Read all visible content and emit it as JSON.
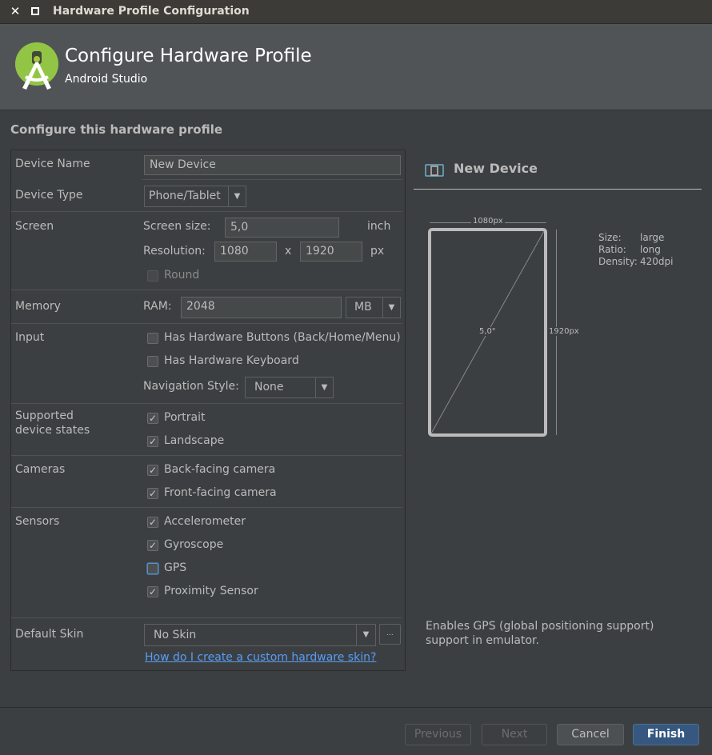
{
  "window": {
    "title": "Hardware Profile Configuration"
  },
  "header": {
    "title": "Configure Hardware Profile",
    "subtitle": "Android Studio"
  },
  "section_title": "Configure this hardware profile",
  "form": {
    "device_name": {
      "label": "Device Name",
      "value": "New Device"
    },
    "device_type": {
      "label": "Device Type",
      "value": "Phone/Tablet"
    },
    "screen": {
      "label": "Screen",
      "size_label": "Screen size:",
      "size_value": "5,0",
      "size_unit": "inch",
      "resolution_label": "Resolution:",
      "res_width": "1080",
      "res_sep": "x",
      "res_height": "1920",
      "res_unit": "px",
      "round_label": "Round",
      "round_checked": false
    },
    "memory": {
      "label": "Memory",
      "ram_label": "RAM:",
      "ram_value": "2048",
      "ram_unit": "MB"
    },
    "input": {
      "label": "Input",
      "hw_buttons": "Has Hardware Buttons (Back/Home/Menu)",
      "hw_keyboard": "Has Hardware Keyboard",
      "nav_style_label": "Navigation Style:",
      "nav_style_value": "None"
    },
    "states": {
      "label_line1": "Supported",
      "label_line2": "device states",
      "portrait": "Portrait",
      "landscape": "Landscape"
    },
    "cameras": {
      "label": "Cameras",
      "back": "Back-facing camera",
      "front": "Front-facing camera"
    },
    "sensors": {
      "label": "Sensors",
      "accelerometer": "Accelerometer",
      "gyroscope": "Gyroscope",
      "gps": "GPS",
      "proximity": "Proximity Sensor"
    },
    "skin": {
      "label": "Default Skin",
      "value": "No Skin",
      "browse": "...",
      "help_link": "How do I create a custom hardware skin?"
    }
  },
  "preview": {
    "title": "New Device",
    "width_label": "1080px",
    "height_label": "1920px",
    "diagonal_label": "5,0\"",
    "specs": [
      {
        "key": "Size:",
        "value": "large"
      },
      {
        "key": "Ratio:",
        "value": "long"
      },
      {
        "key": "Density:",
        "value": "420dpi"
      }
    ],
    "help_text": "Enables GPS (global positioning support) support in emulator."
  },
  "buttons": {
    "previous": "Previous",
    "next": "Next",
    "cancel": "Cancel",
    "finish": "Finish"
  },
  "colors": {
    "background": "#3c3f41",
    "header": "#515456",
    "primary_button": "#365880",
    "link": "#589df6",
    "logo_green": "#a4c639"
  }
}
